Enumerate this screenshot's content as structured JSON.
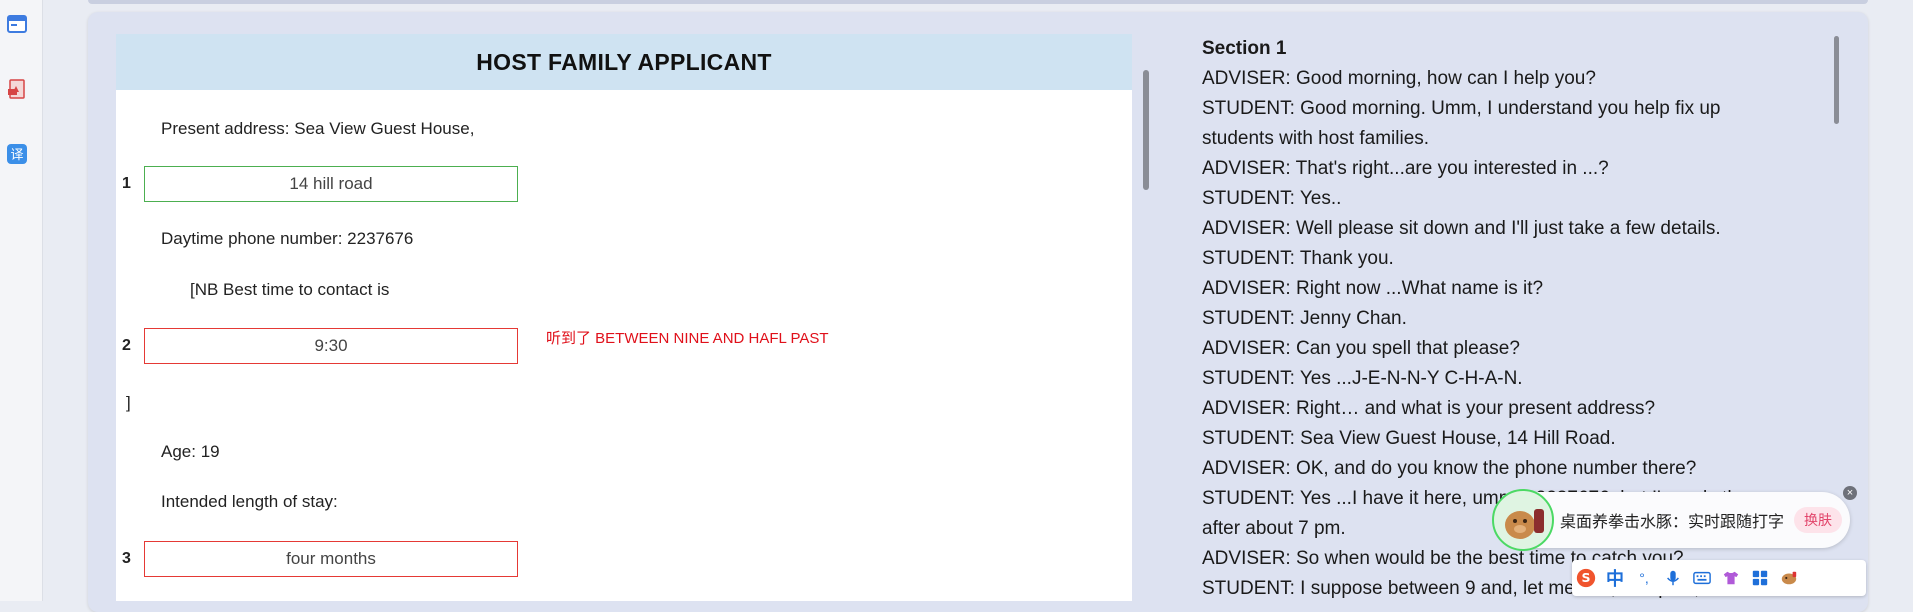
{
  "form": {
    "title": "HOST FAMILY APPLICANT",
    "present_address_label": "Present address: Sea View Guest House,",
    "q1": {
      "number": "1",
      "answer": "14 hill road"
    },
    "phone_label": "Daytime phone number: 2237676",
    "contact_label": "[NB Best time to contact is",
    "q2": {
      "number": "2",
      "answer": "9:30",
      "note": "听到了 BETWEEN NINE AND HAFL PAST"
    },
    "bracket_close": "]",
    "age_label": "Age: 19",
    "stay_label": "Intended length of stay:",
    "q3": {
      "number": "3",
      "answer": "four months"
    }
  },
  "transcript": {
    "section": "Section 1",
    "lines": [
      "ADVISER: Good morning, how can I help you?",
      "STUDENT: Good morning. Umm, I understand you help fix up",
      "students with host families.",
      "ADVISER: That's right...are you interested in ...?",
      "STUDENT: Yes..",
      "ADVISER: Well please sit down and I'll just take a few details.",
      "STUDENT: Thank you.",
      "ADVISER: Right now ...What name is it?",
      "STUDENT: Jenny Chan.",
      "ADVISER: Can you spell that please?",
      "STUDENT: Yes ...J-E-N-N-Y C-H-A-N.",
      "ADVISER: Right… and what is your present address?",
      "STUDENT: Sea View Guest House, 14 Hill Road.",
      "ADVISER: OK, and do you know the phone number there?",
      "STUDENT: Yes ...I have it here, umm... 2237676, but I'm only there",
      "after about 7 pm.",
      "ADVISER: So when would be the best time to catch you?",
      "STUDENT: I suppose between 9 and, let me see, half-past, before I"
    ]
  },
  "ime": {
    "bubble_text": "桌面养拳击水豚：实时跟随打字",
    "switch_label": "换肤",
    "close_glyph": "×",
    "bar_lang": "中",
    "bar_punct": "°,"
  },
  "colors": {
    "correct_border": "#4caf50",
    "wrong_border": "#e53935",
    "note_red": "#e0101a",
    "header_bg": "#cfe3f2"
  }
}
